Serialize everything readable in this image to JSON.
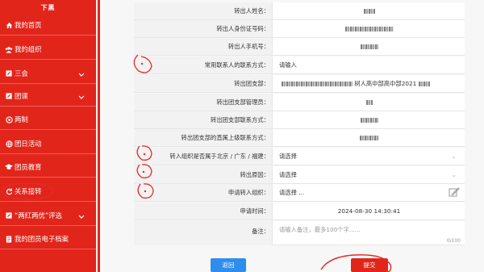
{
  "sidebar": {
    "logo": "下黑",
    "items": [
      {
        "label": "我的首页",
        "icon": "home-icon"
      },
      {
        "label": "我的组织",
        "icon": "group-icon"
      },
      {
        "label": "三会",
        "icon": "edit-square-icon",
        "expandable": true
      },
      {
        "label": "团课",
        "icon": "edit-square-icon",
        "expandable": true
      },
      {
        "label": "两制",
        "icon": "circle-icon"
      },
      {
        "label": "团日活动",
        "icon": "globe-icon"
      },
      {
        "label": "团员教育",
        "icon": "graduation-cap-icon"
      },
      {
        "label": "关系接转",
        "icon": "refresh-icon"
      },
      {
        "label": "“两红两优”评选",
        "icon": "edit-square-icon",
        "expandable": true
      },
      {
        "label": "我的团员电子档案",
        "icon": "document-icon"
      }
    ]
  },
  "form": {
    "rows": [
      {
        "label": "转出人姓名：",
        "value": "",
        "type": "masked"
      },
      {
        "label": "转出人身份证号码：",
        "value": "",
        "type": "masked"
      },
      {
        "label": "转出人手机号：",
        "value": "",
        "type": "masked"
      },
      {
        "label": "常用联系人的联系方式：",
        "placeholder": "请输入",
        "type": "input"
      },
      {
        "label": "转出团支部：",
        "value": "树人高中部高中部2021",
        "type": "partial"
      },
      {
        "label": "转出团支部管理员：",
        "value": "",
        "type": "masked"
      },
      {
        "label": "转出团支部联系方式：",
        "value": "",
        "type": "masked"
      },
      {
        "label": "转出团支部的直属上级联系方式：",
        "value": "",
        "type": "masked"
      },
      {
        "label": "转入组织是否属于北京 / 广东 / 福建：",
        "placeholder": "请选择",
        "type": "select"
      },
      {
        "label": "转出原因：",
        "placeholder": "请选择",
        "type": "select"
      },
      {
        "label": "申请转入组织：",
        "placeholder": "请选择 ...",
        "type": "picker"
      },
      {
        "label": "申请时间：",
        "value": "2024-08-30 14:30:41",
        "type": "text"
      }
    ],
    "remark": {
      "label": "备注：",
      "placeholder": "请输入备注，最多100个字......",
      "counter": "0/100"
    }
  },
  "buttons": {
    "back": "返回",
    "submit": "提交"
  },
  "colors": {
    "brand_red": "#e1251b",
    "back_blue": "#2e8ded",
    "annotation_red": "#e52a2a"
  }
}
